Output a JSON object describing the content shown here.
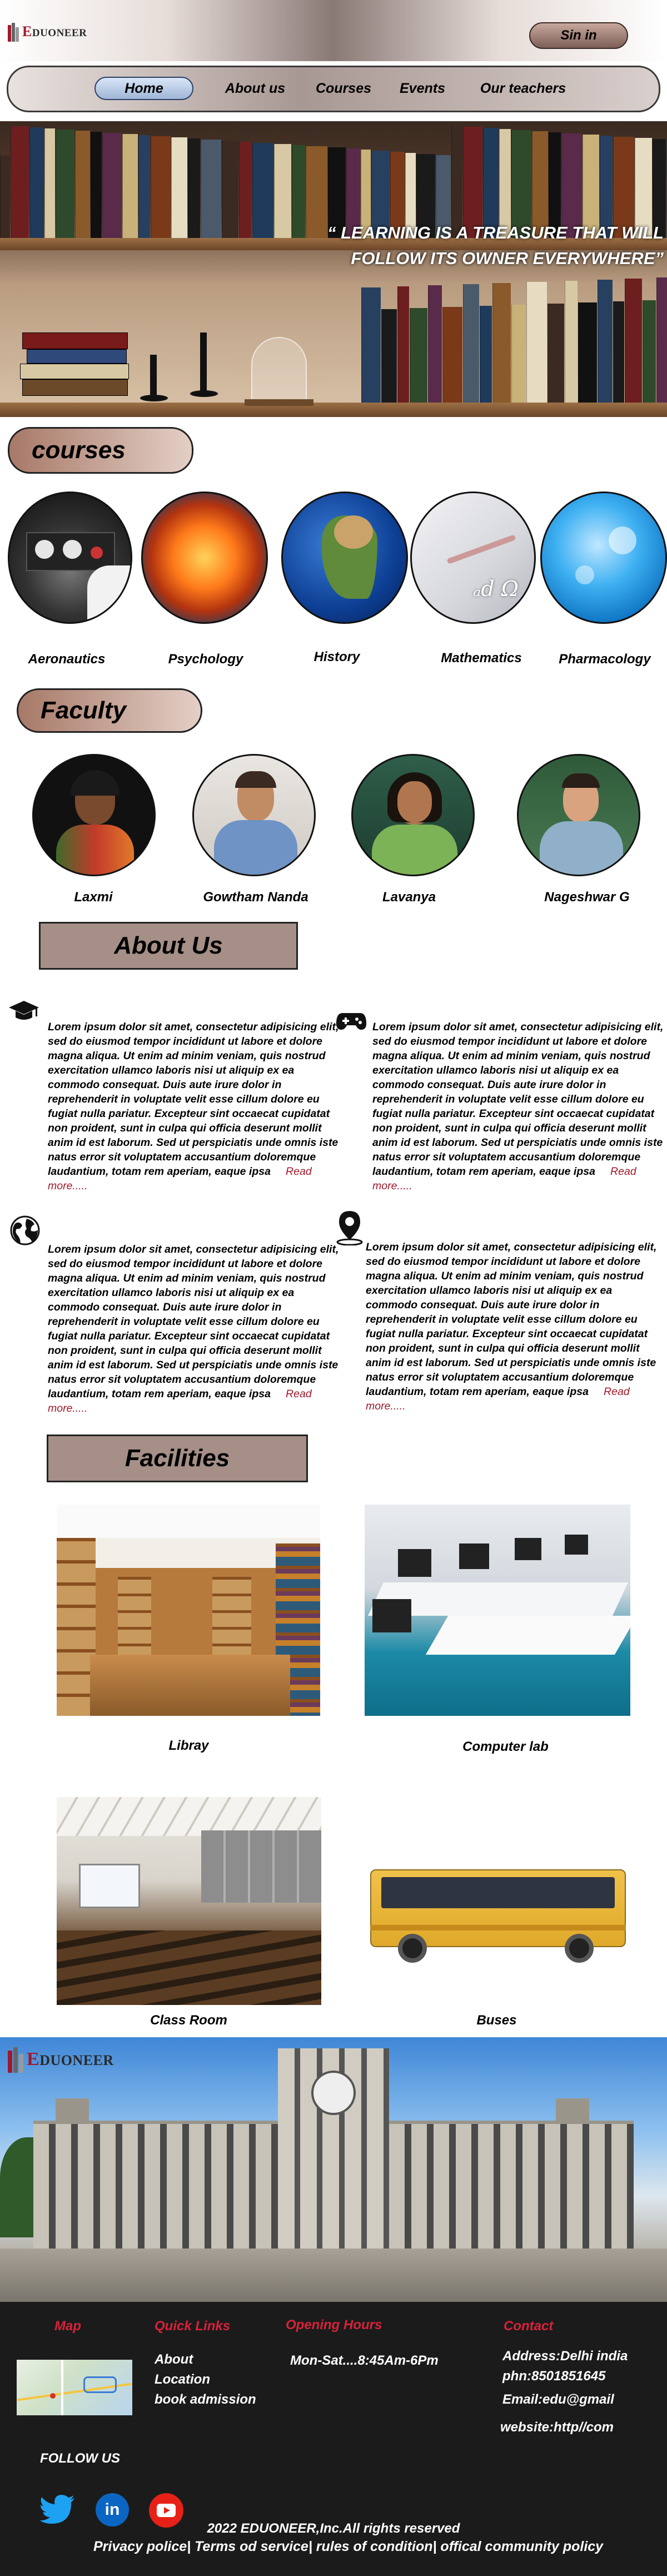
{
  "brand": {
    "name": "EDUONEER",
    "accent": "#a0192b"
  },
  "header": {
    "signin_label": "Sin in"
  },
  "nav": {
    "items": [
      {
        "label": "Home",
        "active": true
      },
      {
        "label": "About us"
      },
      {
        "label": "Courses"
      },
      {
        "label": "Events"
      },
      {
        "label": "Our teachers"
      }
    ]
  },
  "hero": {
    "quote_line1": "“ LEARNING IS A TREASURE THAT WILL",
    "quote_line2": "FOLLOW ITS OWNER EVERYWHERE”"
  },
  "courses": {
    "heading": "courses",
    "items": [
      {
        "label": "Aeronautics",
        "icon": "cockpit-image"
      },
      {
        "label": "Psychology",
        "icon": "brain-image"
      },
      {
        "label": "History",
        "icon": "globe-image"
      },
      {
        "label": "Mathematics",
        "icon": "math-image"
      },
      {
        "label": "Pharmacology",
        "icon": "molecule-image"
      }
    ]
  },
  "faculty": {
    "heading": "Faculty",
    "members": [
      {
        "name": "Laxmi"
      },
      {
        "name": "Gowtham Nanda"
      },
      {
        "name": "Lavanya"
      },
      {
        "name": "Nageshwar G"
      }
    ]
  },
  "about": {
    "heading": "About Us",
    "blocks": [
      {
        "icon": "graduation-cap-icon",
        "text": "Lorem ipsum dolor sit amet, consectetur adipisicing elit, sed do eiusmod tempor incididunt ut labore et dolore magna aliqua. Ut enim ad minim veniam, quis nostrud exercitation ullamco laboris nisi ut aliquip ex ea commodo consequat. Duis aute irure dolor in reprehenderit in voluptate velit esse cillum dolore eu fugiat nulla pariatur. Excepteur sint occaecat cupidatat non proident, sunt in culpa qui officia deserunt mollit anim id est laborum. Sed ut perspiciatis unde omnis iste natus error sit voluptatem accusantium doloremque laudantium, totam rem aperiam, eaque ipsa",
        "read_more": "Read more....."
      },
      {
        "icon": "gamepad-icon",
        "text": "Lorem ipsum dolor sit amet, consectetur adipisicing elit, sed do eiusmod tempor incididunt ut labore et dolore magna aliqua. Ut enim ad minim veniam, quis nostrud exercitation ullamco laboris nisi ut aliquip ex ea commodo consequat. Duis aute irure dolor in reprehenderit in voluptate velit esse cillum dolore eu fugiat nulla pariatur. Excepteur sint occaecat cupidatat non proident, sunt in culpa qui officia deserunt mollit anim id est laborum. Sed ut perspiciatis unde omnis iste natus error sit voluptatem accusantium doloremque laudantium, totam rem aperiam, eaque ipsa",
        "read_more": "Read more....."
      },
      {
        "icon": "globe-icon",
        "text": "Lorem ipsum dolor sit amet, consectetur adipisicing elit, sed do eiusmod tempor incididunt ut labore et dolore magna aliqua. Ut enim ad minim veniam, quis nostrud exercitation ullamco laboris nisi ut aliquip ex ea commodo consequat. Duis aute irure dolor in reprehenderit in voluptate velit esse cillum dolore eu fugiat nulla pariatur. Excepteur sint occaecat cupidatat non proident, sunt in culpa qui officia deserunt mollit anim id est laborum. Sed ut perspiciatis unde omnis iste natus error sit voluptatem accusantium doloremque laudantium, totam rem aperiam, eaque ipsa",
        "read_more": "Read more....."
      },
      {
        "icon": "location-pin-icon",
        "text": "Lorem ipsum dolor sit amet, consectetur adipisicing elit, sed do eiusmod tempor incididunt ut labore et dolore magna aliqua. Ut enim ad minim veniam, quis nostrud exercitation ullamco laboris nisi ut aliquip ex ea commodo consequat. Duis aute irure dolor in reprehenderit in voluptate velit esse cillum dolore eu fugiat nulla pariatur. Excepteur sint occaecat cupidatat non proident, sunt in culpa qui officia deserunt mollit anim id est laborum. Sed ut perspiciatis unde omnis iste natus error sit voluptatem accusantium doloremque laudantium, totam rem aperiam, eaque ipsa",
        "read_more": "Read more....."
      }
    ]
  },
  "facilities": {
    "heading": "Facilities",
    "items": [
      {
        "label": "Libray"
      },
      {
        "label": "Computer lab"
      },
      {
        "label": "Class Room"
      },
      {
        "label": "Buses"
      }
    ]
  },
  "footer": {
    "map_label": "Map",
    "quick_links": {
      "heading": "Quick Links",
      "items": [
        "About",
        "Location",
        "book admission"
      ]
    },
    "opening_hours": {
      "heading": "Opening Hours",
      "text": "Mon-Sat....8:45Am-6Pm"
    },
    "contact": {
      "heading": "Contact",
      "address": "Address:Delhi  india",
      "phone": "phn:8501851645",
      "email": "Email:edu@gmail",
      "website": "website:http//com"
    },
    "follow_label": "FOLLOW US",
    "social": [
      {
        "icon": "twitter-icon",
        "color": "#1da1f2"
      },
      {
        "icon": "linkedin-icon",
        "color": "#0a66c2"
      },
      {
        "icon": "youtube-icon",
        "color": "#e62117"
      }
    ],
    "copyright": "2022 EDUONEER,Inc.All  rights reserved",
    "policy_links": "Privacy police| Terms od service| rules of condition| offical community policy"
  }
}
